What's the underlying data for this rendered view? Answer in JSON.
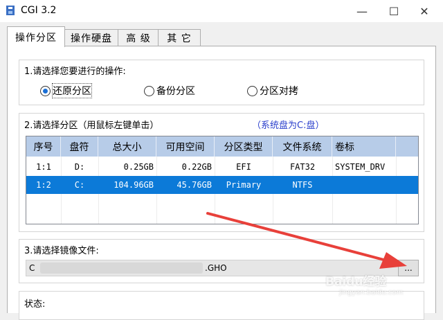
{
  "window": {
    "title": "CGI 3.2",
    "minimize_label": "—",
    "maximize_label": "☐",
    "close_label": "✕"
  },
  "tabs": [
    {
      "label": "操作分区",
      "active": true
    },
    {
      "label": "操作硬盘",
      "active": false
    },
    {
      "label": "高 级",
      "active": false
    },
    {
      "label": "其 它",
      "active": false
    }
  ],
  "operation": {
    "legend": "1.请选择您要进行的操作:",
    "options": [
      {
        "label": "还原分区",
        "selected": true
      },
      {
        "label": "备份分区",
        "selected": false
      },
      {
        "label": "分区对拷",
        "selected": false
      }
    ]
  },
  "partition": {
    "legend": "2.请选择分区（用鼠标左键单击）",
    "note": "（系统盘为C:盘）",
    "columns": [
      "序号",
      "盘符",
      "总大小",
      "可用空间",
      "分区类型",
      "文件系统",
      "卷标"
    ],
    "rows": [
      {
        "cells": [
          "1:1",
          "D:",
          "0.25GB",
          "0.22GB",
          "EFI",
          "FAT32",
          "SYSTEM_DRV"
        ],
        "selected": false
      },
      {
        "cells": [
          "1:2",
          "C:",
          "104.96GB",
          "45.76GB",
          "Primary",
          "NTFS",
          ""
        ],
        "selected": true
      }
    ]
  },
  "image_file": {
    "legend": "3.请选择镜像文件:",
    "path_prefix": "C",
    "path_suffix": ".GHO",
    "browse_label": "..."
  },
  "status": {
    "label": "状态:"
  },
  "watermark": {
    "brand": "Baidu经验",
    "url": "jingyan.baidu.com"
  },
  "colors": {
    "selection": "#0c7ad8",
    "header": "#b7cce8",
    "arrow": "#e8403a",
    "note": "#2a3fcc"
  }
}
